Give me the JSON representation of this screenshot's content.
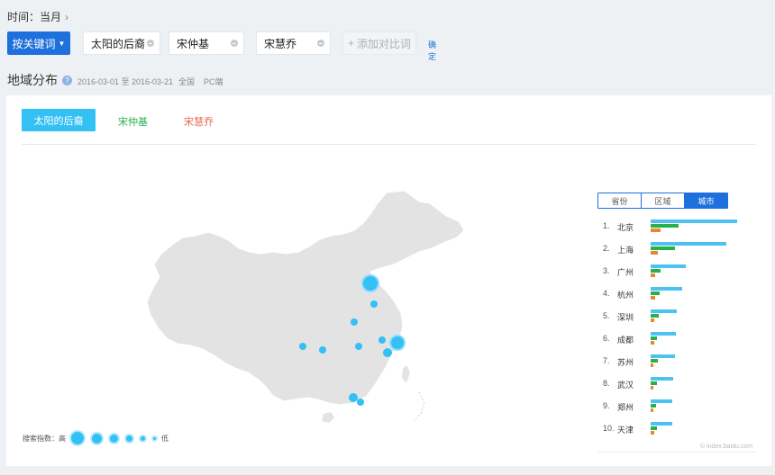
{
  "breadcrumb": {
    "label": "时间：当月",
    "chevron": "›"
  },
  "keywords": {
    "mode_label": "按关键词",
    "items": [
      "太阳的后裔",
      "宋仲基",
      "宋慧乔"
    ],
    "add_label": "添加对比词",
    "confirm_label": "确定"
  },
  "section": {
    "title": "地域分布",
    "help": "?",
    "date_range": "2016-03-01 至 2016-03-21",
    "scope": "全国",
    "platform": "PC端"
  },
  "tabs": [
    {
      "label": "太阳的后裔",
      "color": "#33c0f4"
    },
    {
      "label": "宋仲基",
      "color": "#27b14a"
    },
    {
      "label": "宋慧乔",
      "color": "#e8654a"
    }
  ],
  "legend": {
    "label": "搜索指数：高",
    "low": "低"
  },
  "region_toggle": {
    "items": [
      "省份",
      "区域",
      "城市"
    ],
    "active": 2
  },
  "ranking": [
    {
      "num": "1.",
      "city": "北京",
      "a": 0.96,
      "b": 0.31,
      "c": 0.11
    },
    {
      "num": "2.",
      "city": "上海",
      "a": 0.84,
      "b": 0.27,
      "c": 0.08
    },
    {
      "num": "3.",
      "city": "广州",
      "a": 0.39,
      "b": 0.11,
      "c": 0.05
    },
    {
      "num": "4.",
      "city": "杭州",
      "a": 0.35,
      "b": 0.1,
      "c": 0.05
    },
    {
      "num": "5.",
      "city": "深圳",
      "a": 0.29,
      "b": 0.09,
      "c": 0.04
    },
    {
      "num": "6.",
      "city": "成都",
      "a": 0.28,
      "b": 0.07,
      "c": 0.04
    },
    {
      "num": "7.",
      "city": "苏州",
      "a": 0.27,
      "b": 0.08,
      "c": 0.03
    },
    {
      "num": "8.",
      "city": "武汉",
      "a": 0.25,
      "b": 0.07,
      "c": 0.03
    },
    {
      "num": "9.",
      "city": "郑州",
      "a": 0.24,
      "b": 0.06,
      "c": 0.03
    },
    {
      "num": "10.",
      "city": "天津",
      "a": 0.24,
      "b": 0.07,
      "c": 0.04
    }
  ],
  "watermark": "© index.baidu.com",
  "colors": {
    "accent": "#1e70dc",
    "series_a": "#4cc2f0",
    "series_b": "#27b14a",
    "series_c": "#e48a2c"
  }
}
